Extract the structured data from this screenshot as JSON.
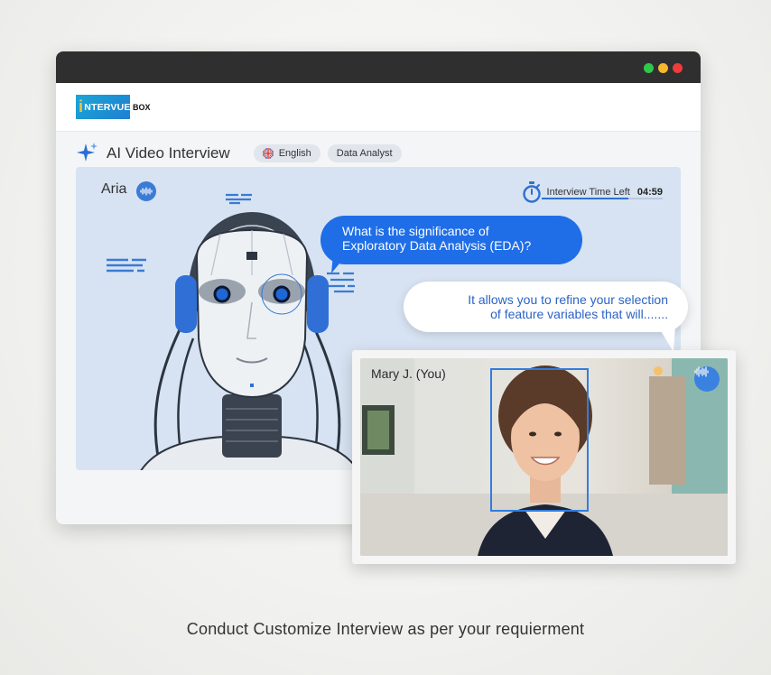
{
  "app": {
    "logo_text": "NTERVUE",
    "logo_suffix": "BOX"
  },
  "window_controls": [
    "#2ec84a",
    "#f5b82e",
    "#ee3b3b"
  ],
  "toolbar": {
    "title": "AI Video Interview",
    "language": "English",
    "role": "Data Analyst"
  },
  "ai_panel": {
    "name": "Aria",
    "timer_label": "Interview Time Left",
    "timer_value": "04:59",
    "question_line1": "What is the significance of",
    "question_line2": "Exploratory Data Analysis (EDA)?"
  },
  "candidate": {
    "name": "Mary J. (You)",
    "answer_line1": "It allows you to refine your selection",
    "answer_line2": "of feature variables that will......."
  },
  "caption": "Conduct Customize Interview as per your requierment",
  "colors": {
    "accent": "#1f6ee8",
    "stage_bg": "#d7e3f2",
    "titlebar": "#2f2f2f"
  }
}
